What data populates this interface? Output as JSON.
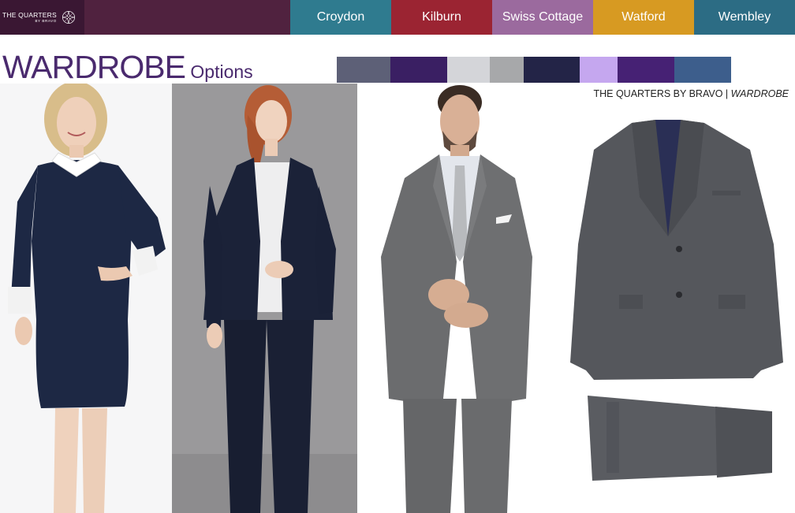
{
  "brand": {
    "name": "THE QUARTERS",
    "byline": "BY BRAVO"
  },
  "nav": {
    "tabs": [
      {
        "label": "Croydon",
        "color": "#2f7b8f"
      },
      {
        "label": "Kilburn",
        "color": "#9b2432"
      },
      {
        "label": "Swiss Cottage",
        "color": "#9b6a9e"
      },
      {
        "label": "Watford",
        "color": "#d79a22"
      },
      {
        "label": "Wembley",
        "color": "#2c6c84"
      }
    ]
  },
  "heading": {
    "main": "WARDROBE",
    "sub": "Options"
  },
  "palette": [
    "#5d6077",
    "#3a1f63",
    "#d4d5d9",
    "#a7a8aa",
    "#232447",
    "#c5a7ef",
    "#462174",
    "#3d5e8c"
  ],
  "tagline": {
    "brand": "THE QUARTERS BY BRAVO | ",
    "section": "WARDROBE"
  },
  "photos": [
    {
      "name": "navy-dress-with-white-collar-photo"
    },
    {
      "name": "navy-trouser-suit-photo"
    },
    {
      "name": "grey-mens-suit-photo"
    },
    {
      "name": "grey-suit-jacket-and-trousers-photo"
    }
  ]
}
